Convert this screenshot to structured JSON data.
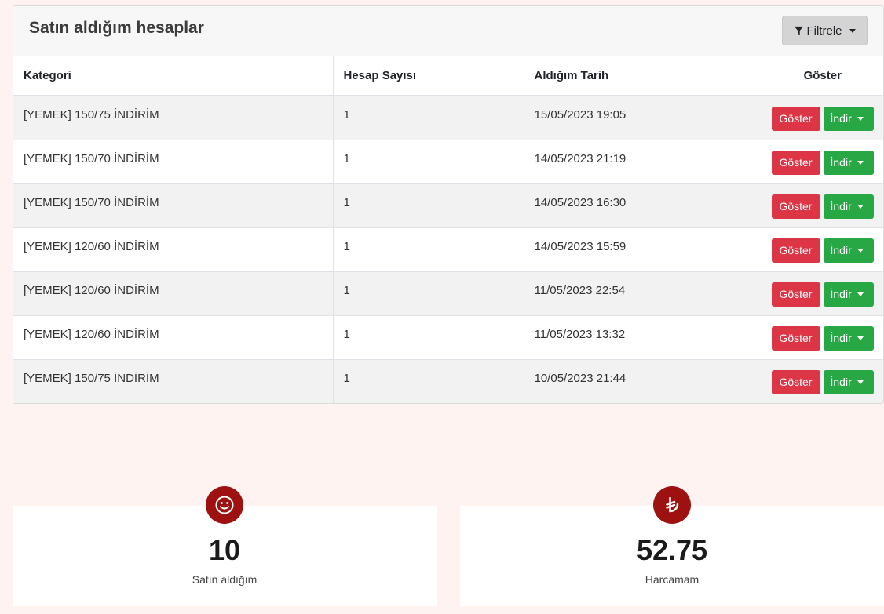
{
  "panel": {
    "title": "Satın aldığım hesaplar",
    "filter_label": "Filtrele"
  },
  "table": {
    "headers": [
      "Kategori",
      "Hesap Sayısı",
      "Aldığım Tarih",
      "Göster"
    ],
    "rows": [
      {
        "kategori": "[YEMEK] 150/75 İNDİRİM",
        "sayi": "1",
        "tarih": "15/05/2023 19:05"
      },
      {
        "kategori": "[YEMEK] 150/70 İNDİRİM",
        "sayi": "1",
        "tarih": "14/05/2023 21:19"
      },
      {
        "kategori": "[YEMEK] 150/70 İNDİRİM",
        "sayi": "1",
        "tarih": "14/05/2023 16:30"
      },
      {
        "kategori": "[YEMEK] 120/60 İNDİRİM",
        "sayi": "1",
        "tarih": "14/05/2023 15:59"
      },
      {
        "kategori": "[YEMEK] 120/60 İNDİRİM",
        "sayi": "1",
        "tarih": "11/05/2023 22:54"
      },
      {
        "kategori": "[YEMEK] 120/60 İNDİRİM",
        "sayi": "1",
        "tarih": "11/05/2023 13:32"
      },
      {
        "kategori": "[YEMEK] 150/75 İNDİRİM",
        "sayi": "1",
        "tarih": "10/05/2023 21:44"
      }
    ],
    "show_label": "Göster",
    "download_label": "İndir"
  },
  "stats": [
    {
      "value": "10",
      "label": "Satın aldığım",
      "icon": "smiley-icon"
    },
    {
      "value": "52.75",
      "label": "Harcamam",
      "icon": "lira-icon"
    }
  ],
  "colors": {
    "accent": "#9e1111",
    "danger": "#dc3545",
    "success": "#28a745",
    "page_bg": "#fff3f2"
  }
}
